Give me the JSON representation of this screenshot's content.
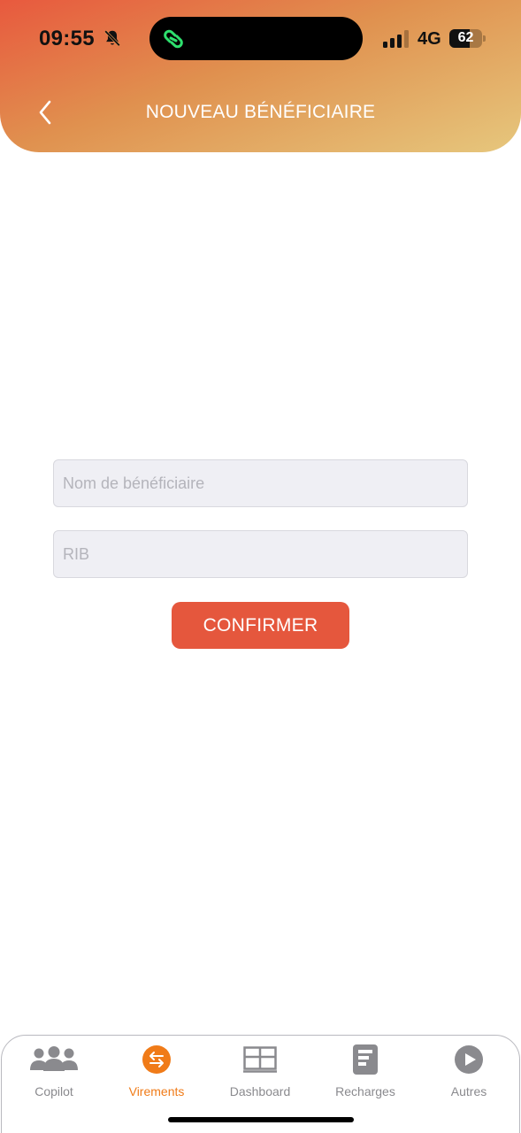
{
  "status_bar": {
    "time": "09:55",
    "network": "4G",
    "battery": "62",
    "battery_level": 0.62
  },
  "header": {
    "title": "NOUVEAU BÉNÉFICIAIRE",
    "gradient_colors": [
      "#e8593e",
      "#e0914f",
      "#e6c77d"
    ]
  },
  "form": {
    "name_placeholder": "Nom de bénéficiaire",
    "name_value": "",
    "rib_placeholder": "RIB",
    "rib_value": "",
    "confirm_label": "CONFIRMER",
    "confirm_color": "#e5573d"
  },
  "tabbar": {
    "active_color": "#f07b18",
    "inactive_color": "#8a8a8e",
    "items": [
      {
        "label": "Copilot",
        "icon": "people-icon",
        "active": false
      },
      {
        "label": "Virements",
        "icon": "transfer-icon",
        "active": true
      },
      {
        "label": "Dashboard",
        "icon": "grid-icon",
        "active": false
      },
      {
        "label": "Recharges",
        "icon": "document-icon",
        "active": false
      },
      {
        "label": "Autres",
        "icon": "play-icon",
        "active": false
      }
    ]
  }
}
